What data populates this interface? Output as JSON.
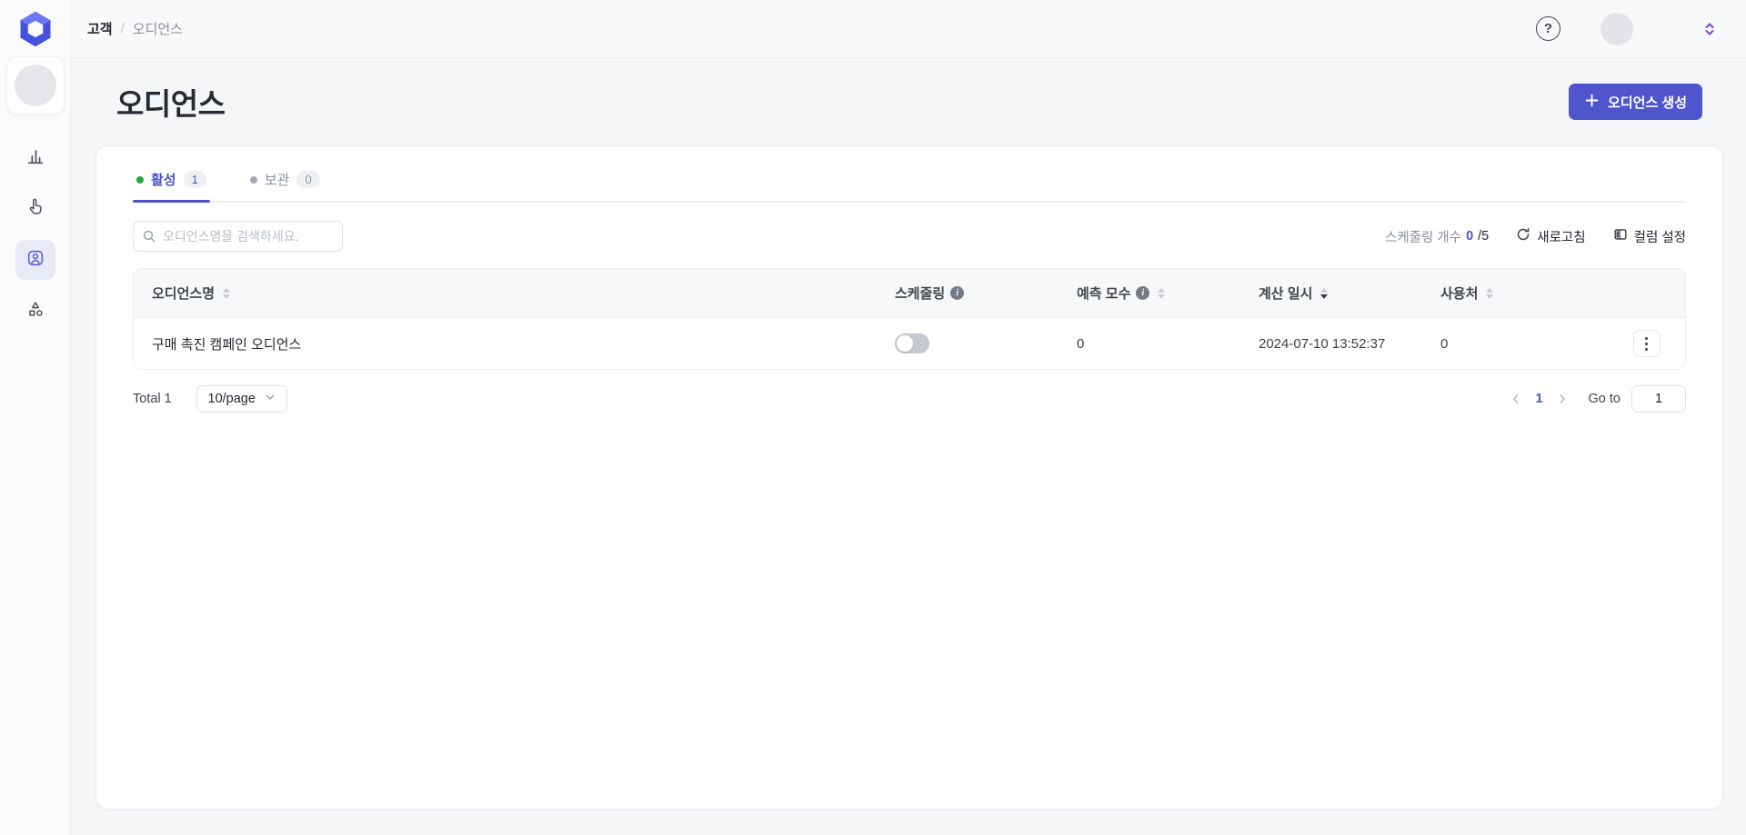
{
  "topbar": {
    "breadcrumb": {
      "root": "고객",
      "separator": "/",
      "current": "오디언스"
    },
    "help_glyph": "?"
  },
  "page": {
    "title": "오디언스",
    "create_button_label": "오디언스 생성"
  },
  "tabs": {
    "active": {
      "label": "활성",
      "count": "1"
    },
    "archived": {
      "label": "보관",
      "count": "0"
    }
  },
  "toolbar": {
    "search_placeholder": "오디언스명을 검색하세요.",
    "scheduling_count_label": "스케줄링 개수",
    "scheduling_used": "0",
    "scheduling_total": "/5",
    "refresh_label": "새로고침",
    "column_settings_label": "컬럼 설정"
  },
  "icons": {
    "info_glyph": "i"
  },
  "table": {
    "columns": {
      "name": "오디언스명",
      "scheduling": "스케줄링",
      "predicted": "예측 모수",
      "calculated_at": "계산 일시",
      "usage": "사용처"
    },
    "rows": [
      {
        "name": "구매 촉진 캠페인 오디언스",
        "scheduling_enabled": false,
        "predicted": "0",
        "calculated_at": "2024-07-10 13:52:37",
        "usage": "0"
      }
    ]
  },
  "pagination": {
    "total_label": "Total 1",
    "page_size": "10/page",
    "current_page": "1",
    "goto_label": "Go to",
    "goto_value": "1"
  },
  "colors": {
    "accent_indigo": "#4f55cd",
    "active_tab": "#4c53c9",
    "status_green": "#2aa73a",
    "toggle_off_track": "#c5c8d2"
  }
}
